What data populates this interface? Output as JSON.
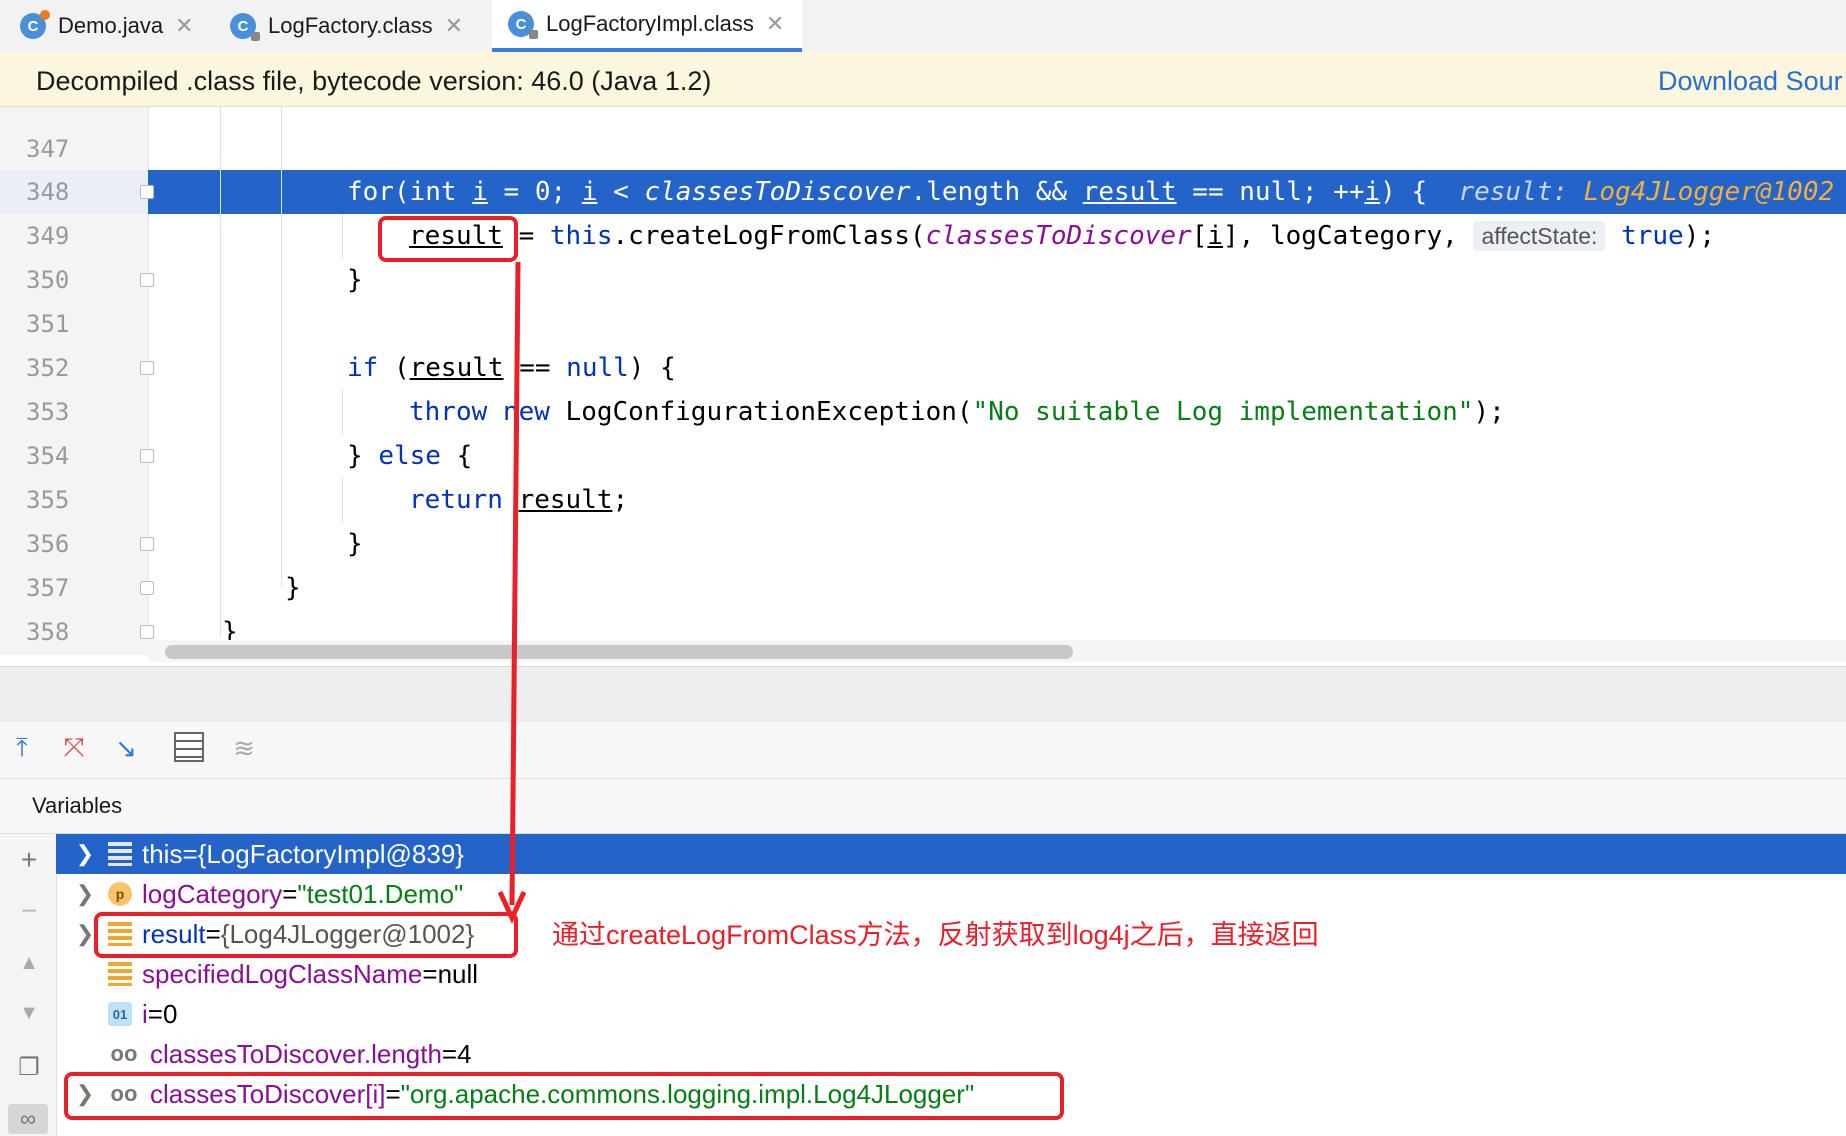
{
  "tabs": [
    {
      "label": "Demo.java",
      "icon": "java-class-icon"
    },
    {
      "label": "LogFactory.class",
      "icon": "class-locked-icon"
    },
    {
      "label": "LogFactoryImpl.class",
      "icon": "class-icon",
      "active": true
    }
  ],
  "banner": {
    "text": "Decompiled .class file, bytecode version: 46.0 (Java 1.2)",
    "link": "Download Sour"
  },
  "gutter": {
    "lines": [
      "347",
      "348",
      "349",
      "350",
      "351",
      "352",
      "353",
      "354",
      "355",
      "356",
      "357",
      "358"
    ]
  },
  "code": {
    "l348": {
      "p1": "for(int ",
      "i1": "i",
      "p2": " = 0; ",
      "i2": "i",
      "p3": " < ",
      "f1": "classesToDiscover",
      "p4": ".length && ",
      "r1": "result",
      "p5": " == null; ++",
      "i3": "i",
      "p6": ") {",
      "hint_label": "result: ",
      "hint_value": "Log4JLogger@1002"
    },
    "l349": {
      "r": "result",
      "eq": " = ",
      "this": "this",
      "call": ".createLogFromClass(",
      "f": "classesToDiscover",
      "idx1": "[",
      "i": "i",
      "idx2": "], logCategory, ",
      "hint": "affectState:",
      "true": "true",
      "end": ");"
    },
    "l350": "}",
    "l352": {
      "kw": "if",
      "p1": " (",
      "r": "result",
      "p2": " == ",
      "null": "null",
      "p3": ") {"
    },
    "l353": {
      "kw": "throw",
      "new": "new",
      "cls": " LogConfigurationException(",
      "str": "\"No suitable Log implementation\"",
      "end": ");"
    },
    "l354": {
      "p1": "} ",
      "kw": "else",
      "p2": " {"
    },
    "l355": {
      "kw": "return",
      "r": "result",
      "end": ";"
    },
    "l356": "}",
    "l357": "}",
    "l358": "}"
  },
  "debug": {
    "variables_label": "Variables",
    "variables": [
      {
        "name": "this",
        "eq": " = ",
        "value": "{LogFactoryImpl@839}",
        "kind": "field",
        "expandable": true,
        "selected": true
      },
      {
        "name": "logCategory",
        "eq": " = ",
        "value": "\"test01.Demo\"",
        "kind": "param",
        "icon_text": "p",
        "expandable": true
      },
      {
        "name": "result",
        "eq": " = ",
        "value": "{Log4JLogger@1002}",
        "kind": "field",
        "expandable": true
      },
      {
        "name": "specifiedLogClassName",
        "eq": " = ",
        "value": "null",
        "kind": "field",
        "expandable": false
      },
      {
        "name": "i",
        "eq": " = ",
        "value": "0",
        "kind": "local",
        "icon_text": "01",
        "expandable": false
      },
      {
        "name": "classesToDiscover.length",
        "eq": " = ",
        "value": "4",
        "kind": "watch",
        "expandable": false
      },
      {
        "name": "classesToDiscover[i]",
        "eq": " = ",
        "value": "\"org.apache.commons.logging.impl.Log4JLogger\"",
        "kind": "watch",
        "expandable": true
      }
    ]
  },
  "annotation": {
    "text": "通过createLogFromClass方法，反射获取到log4j之后，直接返回",
    "color": "#e8202a"
  },
  "colors": {
    "selection": "#2464c8",
    "keyword": "#0033b3",
    "field": "#871094",
    "string": "#067d17"
  }
}
